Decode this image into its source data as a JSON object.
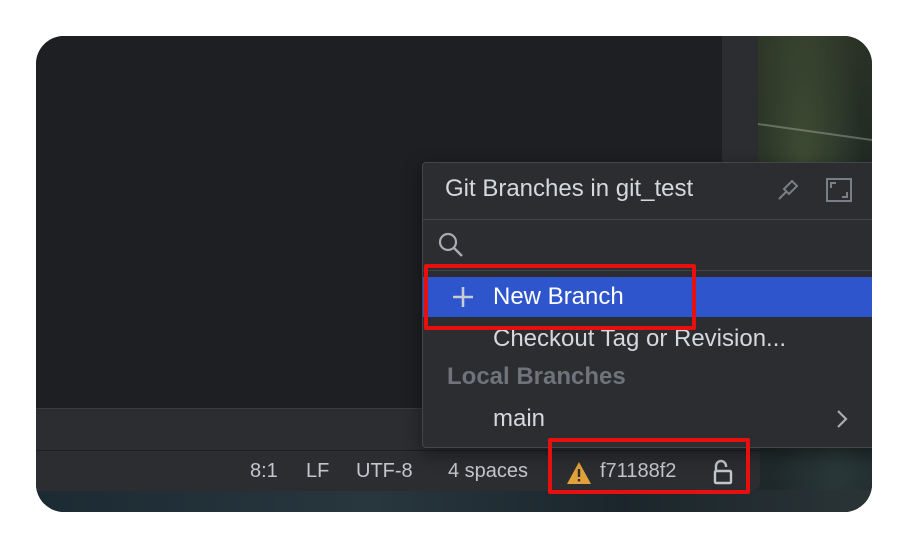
{
  "popup": {
    "title": "Git Branches in git_test",
    "search": {
      "placeholder": "",
      "value": ""
    },
    "actions": [
      {
        "label": "New Branch",
        "icon": "plus-icon",
        "selected": true
      },
      {
        "label": "Checkout Tag or Revision..."
      }
    ],
    "section_header": "Local Branches",
    "branches": [
      {
        "name": "main",
        "icon": "chevron-right-icon"
      }
    ]
  },
  "status_bar": {
    "position": "8:1",
    "line_separator": "LF",
    "encoding": "UTF-8",
    "indent": "4 spaces",
    "vcs_revision": "f71188f2",
    "vcs_icon": "warning-icon",
    "lock_icon": "unlocked-icon"
  },
  "colors": {
    "selection": "#2e55cc",
    "highlight_box": "#e8100f",
    "warning": "#e0a13a"
  }
}
